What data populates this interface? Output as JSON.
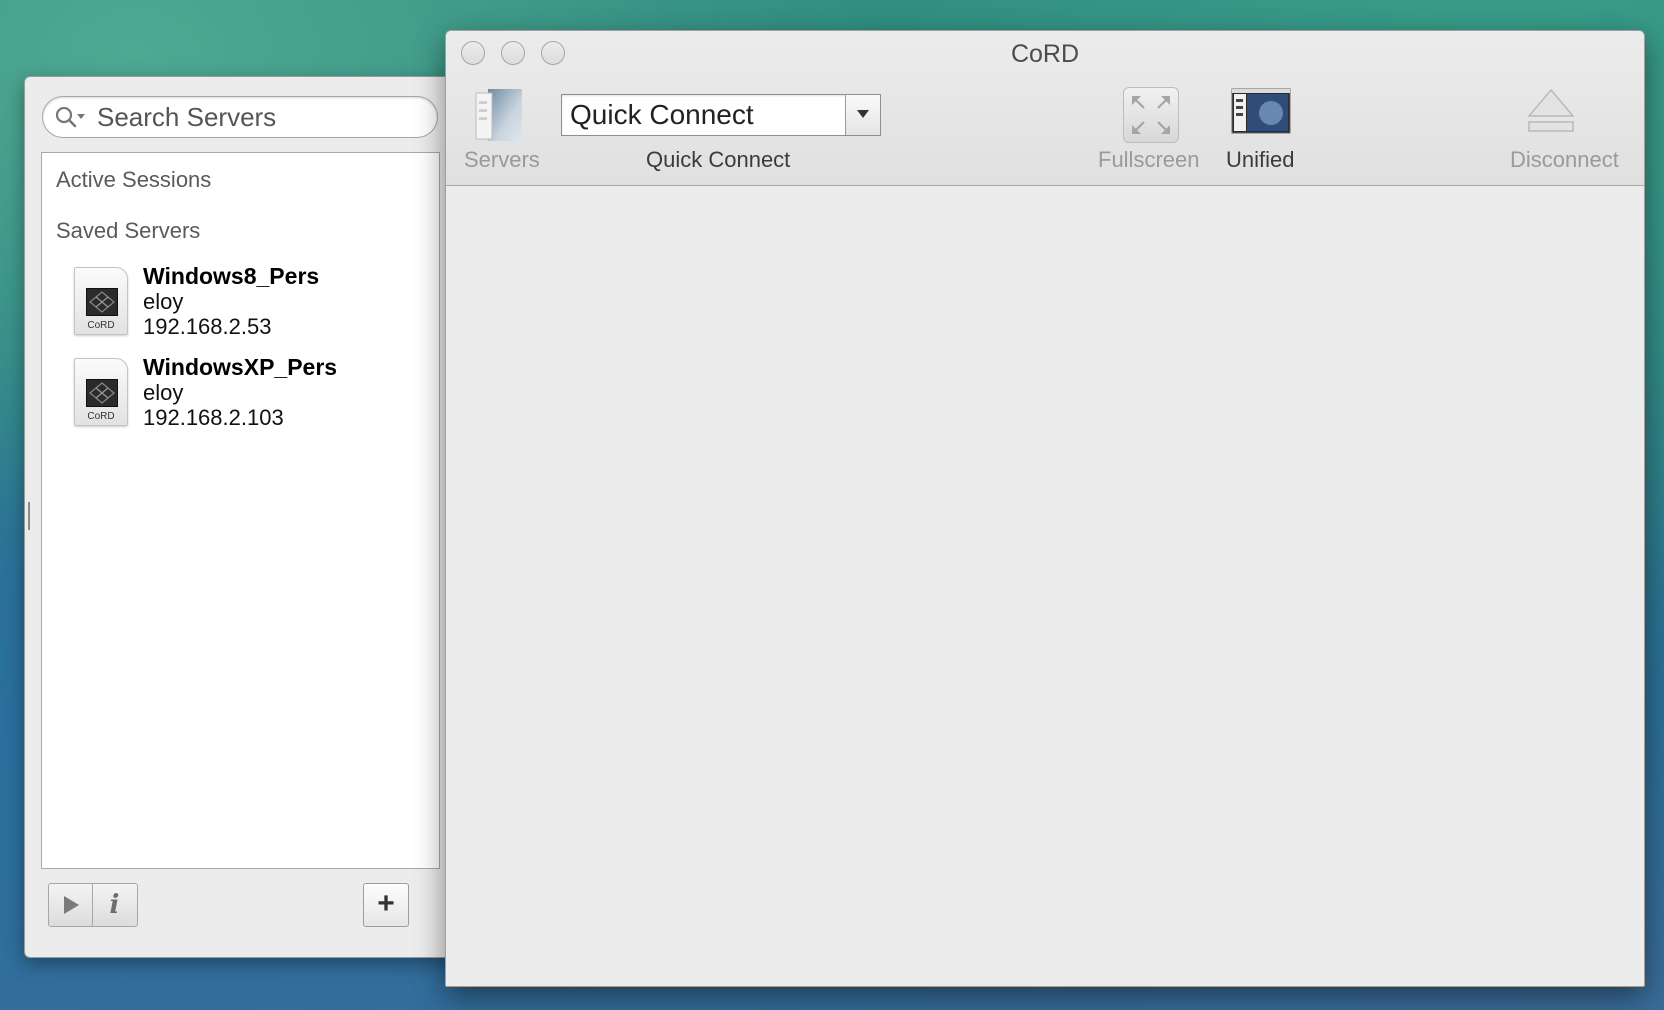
{
  "window": {
    "title": "CoRD"
  },
  "drawer": {
    "search": {
      "placeholder": "Search Servers",
      "value": ""
    },
    "sections": {
      "active": "Active Sessions",
      "saved": "Saved Servers"
    },
    "servers": [
      {
        "name": "Windows8_Pers",
        "user": "eloy",
        "address": "192.168.2.53",
        "icon_caption": "CoRD"
      },
      {
        "name": "WindowsXP_Pers",
        "user": "eloy",
        "address": "192.168.2.103",
        "icon_caption": "CoRD"
      }
    ],
    "buttons": {
      "play_icon": "play-icon",
      "info_label": "i",
      "add_label": "+"
    }
  },
  "toolbar": {
    "servers_label": "Servers",
    "quick_connect": {
      "value": "Quick Connect",
      "label": "Quick Connect"
    },
    "fullscreen_label": "Fullscreen",
    "unified_label": "Unified",
    "disconnect_label": "Disconnect"
  },
  "colors": {
    "window_bg": "#ececec",
    "disabled_text": "#9a9a9a",
    "enabled_text": "#3b3b3b"
  }
}
